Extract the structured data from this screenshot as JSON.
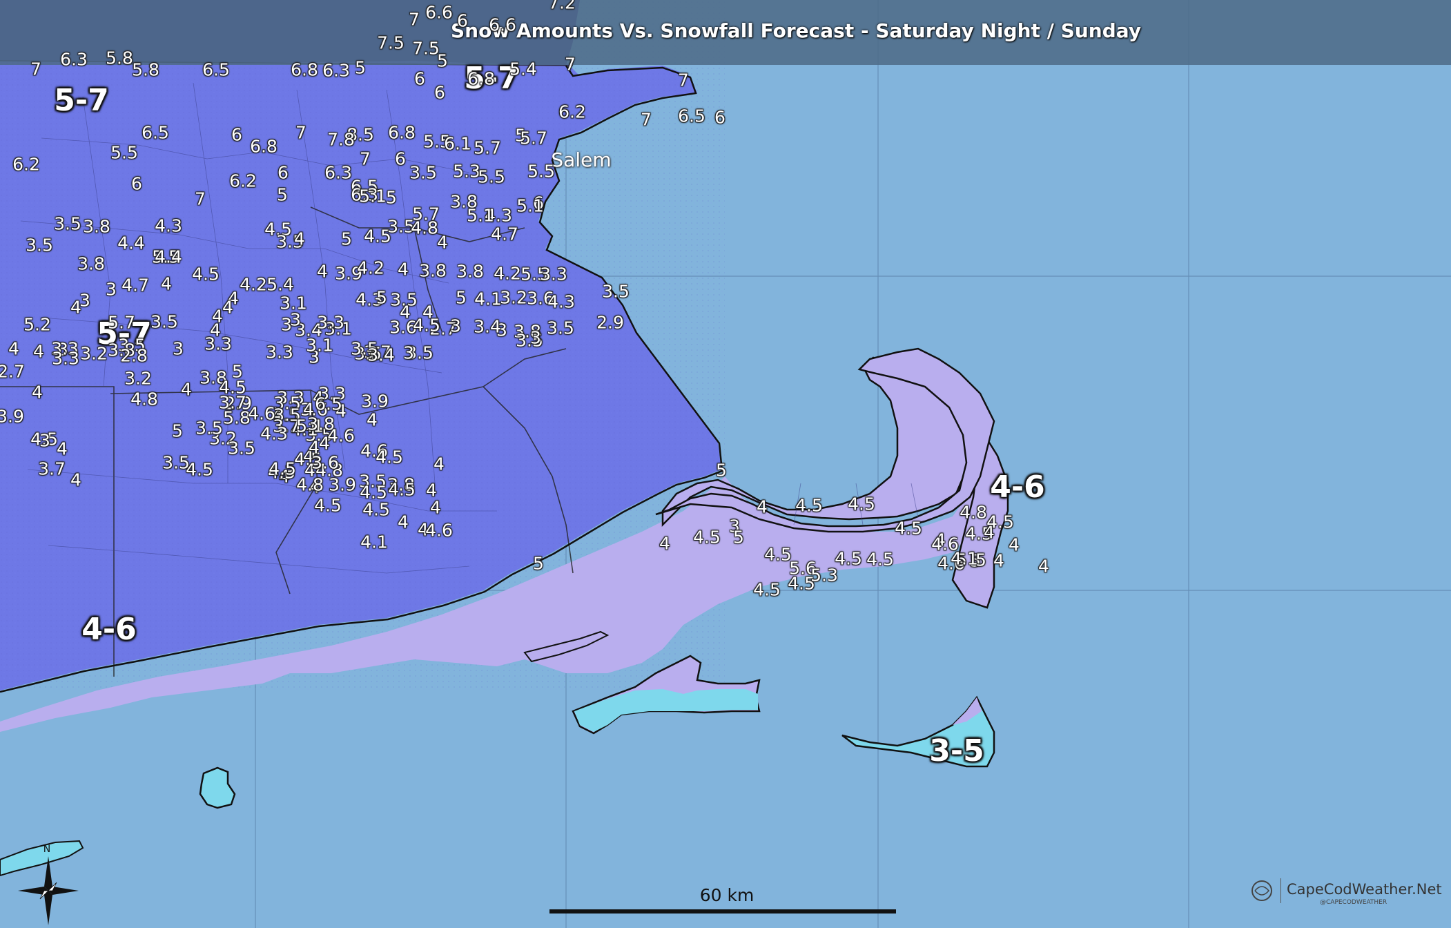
{
  "title": "Snow Amounts Vs. Snowfall Forecast - Saturday Night / Sunday",
  "colors": {
    "ocean": "#82b4dc",
    "band_5_7": "#6e78e6",
    "band_4_6_inland": "#6e78e6",
    "band_4_6_coast": "#b9aeee",
    "band_3_5": "#7ed8ec",
    "north_dark": "#4b52a8",
    "title_bar": "#4e6a86"
  },
  "ranges": [
    {
      "text": "5-7"
    },
    {
      "text": "5-7"
    },
    {
      "text": "5-7"
    },
    {
      "text": "4-6"
    },
    {
      "text": "4-6"
    },
    {
      "text": "3-5"
    }
  ],
  "city": "Salem",
  "top_clipped": [
    "6.6",
    "7",
    "6",
    "6.6",
    "7.2"
  ],
  "readings": [
    "7",
    "6.3",
    "5.8",
    "5.8",
    "6.5",
    "6.8",
    "6.3",
    "5",
    "7.5",
    "5",
    "6",
    "6",
    "5.4",
    "7",
    "7",
    "7.5",
    "6.8",
    "6.2",
    "7",
    "6.5",
    "6",
    "6.5",
    "6",
    "6.8",
    "7",
    "8.5",
    "7.8",
    "6.8",
    "5.5",
    "6.1",
    "5.7",
    "5",
    "5.7",
    "5.5",
    "6.2",
    "6",
    "6.3",
    "7",
    "6",
    "3.5",
    "5.3",
    "5.5",
    "5.5",
    "6",
    "7",
    "6.2",
    "5",
    "6.5",
    "6.3",
    "5",
    "3.8",
    "6",
    "4.3",
    "5.1",
    "5.1",
    "5.1",
    "5.7",
    "3.5",
    "3.8",
    "4.3",
    "3.5",
    "4.4",
    "4.5",
    "3.5",
    "4",
    "5",
    "4.5",
    "3.5",
    "4.8",
    "4",
    "4.7",
    "5.5",
    "3.8",
    "4.4",
    "4.7",
    "4",
    "4.5",
    "4.2",
    "5.4",
    "4",
    "3.9",
    "4.2",
    "4",
    "3.8",
    "3.8",
    "4.2",
    "5.5",
    "3.3",
    "3",
    "3",
    "4",
    "4",
    "4.3",
    "5",
    "3.5",
    "4",
    "5",
    "4.1",
    "3.2",
    "3.6",
    "4.3",
    "3.5",
    "5.2",
    "5.7",
    "3.5",
    "4",
    "3.1",
    "3.4",
    "3.6",
    "3",
    "3.8",
    "3.5",
    "3.4",
    "2.7",
    "2.9",
    "3.5",
    "3.5",
    "3",
    "3.7",
    "3.5",
    "4",
    "3",
    "3.2",
    "3.5",
    "3",
    "3.3",
    "3.3",
    "3",
    "3.5",
    "3.4",
    "4.5",
    "3",
    "3",
    "2.7",
    "4",
    "3.3",
    "3.3",
    "3.8",
    "2.8",
    "4",
    "4",
    "3",
    "3",
    "3.3",
    "3.1",
    "3.9",
    "5",
    "3.2",
    "3.5",
    "5.8",
    "2.9",
    "3.3",
    "3.5",
    "3.3",
    "3.6",
    "3.9",
    "4",
    "3.1",
    "4",
    "3.2",
    "4",
    "3.8",
    "4.5",
    "5",
    "3.7",
    "4.5",
    "4",
    "4.5",
    "3.5",
    "4.1",
    "3.5",
    "3.5",
    "3",
    "3.7",
    "4",
    "4.8",
    "3.5",
    "3.7",
    "4",
    "4",
    "4",
    "4",
    "4.5",
    "4",
    "5.1",
    "4.6",
    "4",
    "3.8",
    "4.6",
    "4.5",
    "4",
    "6.5",
    "4.3",
    "4.6",
    "4.3",
    "4",
    "4",
    "4.5",
    "4.8",
    "4",
    "3.9",
    "3.5",
    "3.6",
    "4.8",
    "4.5",
    "3.8",
    "4.5",
    "4",
    "4",
    "4",
    "4.5",
    "4.5",
    "4.5",
    "4.1",
    "4",
    "4",
    "4.6",
    "5",
    "5",
    "4",
    "4.5",
    "4.5",
    "4.5",
    "4.5",
    "4",
    "4",
    "4.6",
    "5",
    "4",
    "4",
    "3",
    "4",
    "4.5",
    "5",
    "4.5",
    "5.6",
    "4.5",
    "4.5",
    "4.5",
    "5.3",
    "4.5",
    "4.8",
    "4.5",
    "4.6",
    "5",
    "5",
    "4",
    "4.1"
  ],
  "scale": {
    "label": "60 km"
  },
  "credit": {
    "name": "CapeCodWeather.Net",
    "handle": "@CAPECODWEATHER"
  },
  "compass": {
    "north": "N"
  }
}
